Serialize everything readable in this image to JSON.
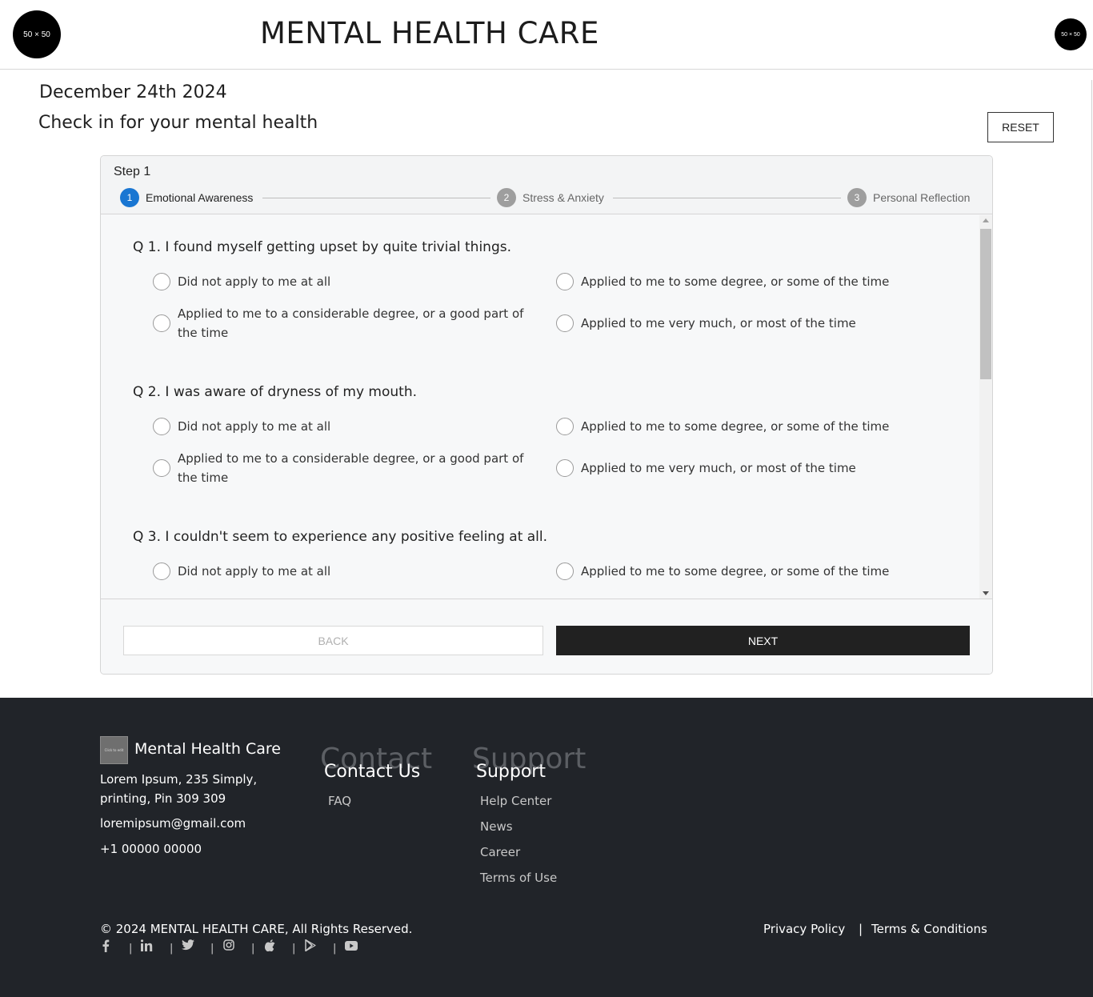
{
  "header": {
    "logo_text": "50 × 50",
    "title": "MENTAL HEALTH CARE",
    "avatar_text": "50 × 50"
  },
  "page": {
    "date": "December 24th 2024",
    "subtitle": "Check in for your mental health",
    "reset_label": "RESET"
  },
  "stepper": {
    "caption": "Step 1",
    "steps": [
      {
        "num": "1",
        "label": "Emotional Awareness",
        "active": true
      },
      {
        "num": "2",
        "label": "Stress & Anxiety",
        "active": false
      },
      {
        "num": "3",
        "label": "Personal Reflection",
        "active": false
      }
    ]
  },
  "questions": [
    {
      "text": "Q 1. I found myself getting upset by quite trivial things.",
      "options": [
        "Did not apply to me at all",
        "Applied to me to some degree, or some of the time",
        "Applied to me to a considerable degree, or a good part of the time",
        "Applied to me very much, or most of the time"
      ]
    },
    {
      "text": "Q 2. I was aware of dryness of my mouth.",
      "options": [
        "Did not apply to me at all",
        "Applied to me to some degree, or some of the time",
        "Applied to me to a considerable degree, or a good part of the time",
        "Applied to me very much, or most of the time"
      ]
    },
    {
      "text": "Q 3. I couldn't seem to experience any positive feeling at all.",
      "options": [
        "Did not apply to me at all",
        "Applied to me to some degree, or some of the time"
      ]
    }
  ],
  "actions": {
    "back_label": "BACK",
    "next_label": "NEXT"
  },
  "footer": {
    "logo_text": "Click to edit",
    "brand": "Mental Health Care",
    "address": "Lorem Ipsum, 235 Simply, printing, Pin 309 309",
    "email": "loremipsum@gmail.com",
    "phone": "+1 00000 00000",
    "contact_heading": "Contact Us",
    "contact_ghost": "Contact",
    "contact_links": [
      "FAQ"
    ],
    "support_heading": "Support",
    "support_ghost": "Support",
    "support_links": [
      "Help Center",
      "News",
      "Career",
      "Terms of Use"
    ],
    "copyright": "© 2024 MENTAL HEALTH CARE, All Rights Reserved.",
    "privacy": "Privacy Policy",
    "divider": "|",
    "terms": "Terms & Conditions",
    "social_icons": [
      "facebook-icon",
      "linkedin-icon",
      "twitter-icon",
      "instagram-icon",
      "apple-icon",
      "google-play-icon",
      "youtube-icon"
    ]
  }
}
